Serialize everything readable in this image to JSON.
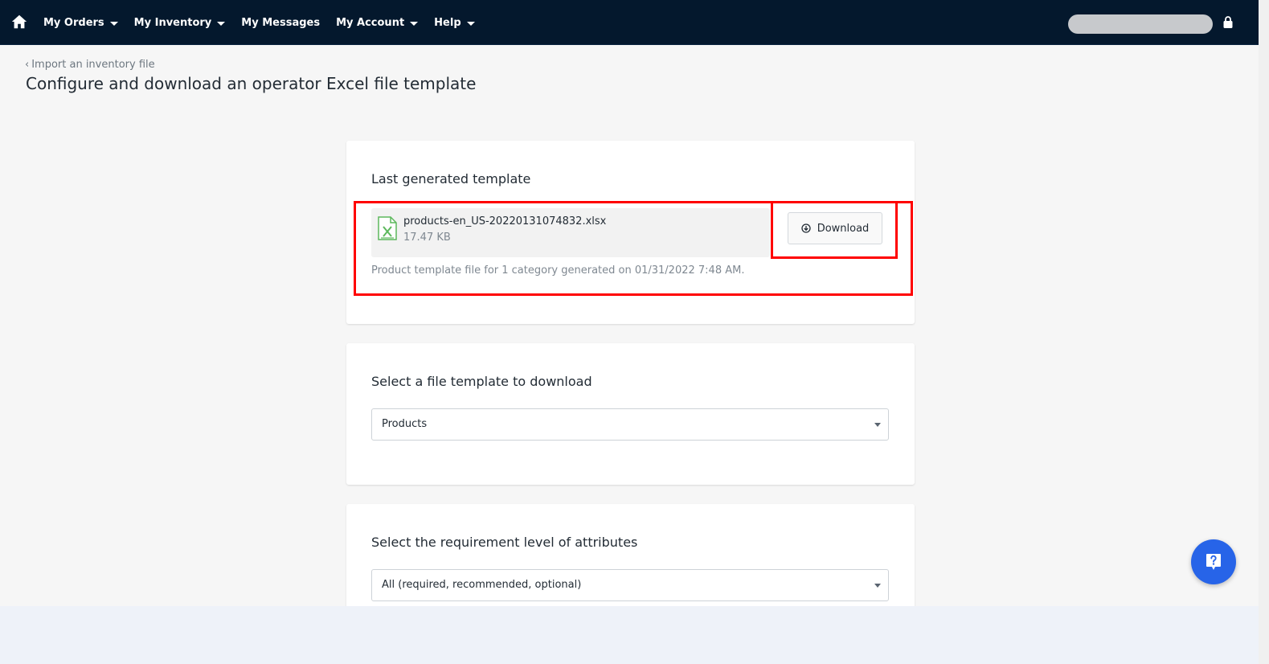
{
  "nav": {
    "home_icon": "home-icon",
    "items": [
      {
        "label": "My Orders",
        "dropdown": true
      },
      {
        "label": "My Inventory",
        "dropdown": true
      },
      {
        "label": "My Messages",
        "dropdown": false
      },
      {
        "label": "My Account",
        "dropdown": true
      },
      {
        "label": "Help",
        "dropdown": true
      }
    ],
    "lock_icon": "lock-icon"
  },
  "breadcrumb": {
    "label": "Import an inventory file"
  },
  "page_title": "Configure and download an operator Excel file template",
  "last_template": {
    "title": "Last generated template",
    "file_name": "products-en_US-20220131074832.xlsx",
    "file_size": "17.47 KB",
    "file_icon": "excel-file-icon",
    "download_label": "Download",
    "description": "Product template file for 1 category generated on 01/31/2022 7:48 AM."
  },
  "file_template": {
    "title": "Select a file template to download",
    "selected": "Products"
  },
  "requirement_level": {
    "title": "Select the requirement level of attributes",
    "selected": "All (required, recommended, optional)"
  },
  "colors": {
    "navbar": "#04182d",
    "highlight": "#ff0000",
    "fab": "#2764e8"
  }
}
